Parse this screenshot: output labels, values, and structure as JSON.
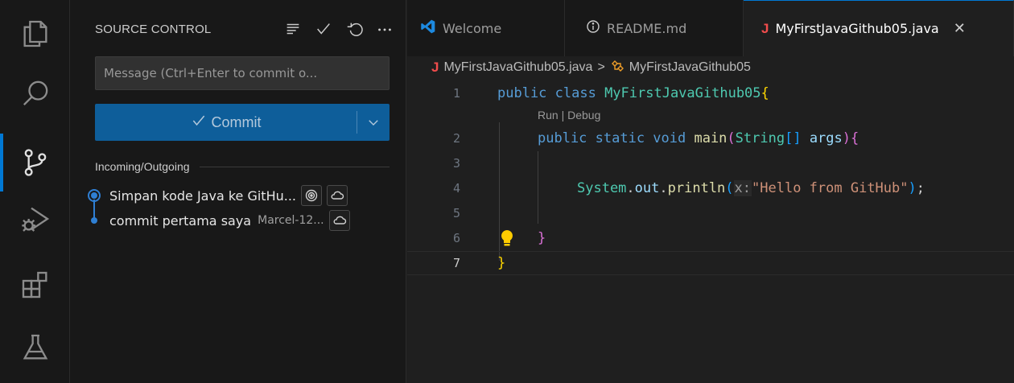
{
  "activity_bar": {
    "items": [
      "explorer-icon",
      "search-icon",
      "source-control-icon",
      "run-debug-icon",
      "extensions-icon",
      "testing-icon"
    ],
    "active": "source-control-icon"
  },
  "sidebar": {
    "title": "SOURCE CONTROL",
    "actions": [
      "view-as-tree-icon",
      "check-icon",
      "refresh-icon",
      "more-icon"
    ],
    "message_placeholder": "Message (Ctrl+Enter to commit o...",
    "commit_label": "Commit",
    "incoming_outgoing_label": "Incoming/Outgoing",
    "commits": [
      {
        "message": "Simpan kode Java ke GitHu...",
        "author": ""
      },
      {
        "message": "commit pertama saya",
        "author": "Marcel-12..."
      }
    ]
  },
  "editor": {
    "tabs": [
      {
        "label": "Welcome",
        "icon": "vscode-icon"
      },
      {
        "label": "README.md",
        "icon": "info-icon"
      },
      {
        "label": "MyFirstJavaGithub05.java",
        "icon": "java-icon",
        "active": true
      }
    ],
    "breadcrumb": {
      "file": "MyFirstJavaGithub05.java",
      "separator": ">",
      "symbol": "MyFirstJavaGithub05"
    },
    "codelens": "Run | Debug",
    "line_numbers": [
      "1",
      "2",
      "3",
      "4",
      "5",
      "6",
      "7"
    ],
    "current_line": "7",
    "code": {
      "l1_kw": "public class ",
      "l1_cls": "MyFirstJavaGithub05",
      "l1_brace": "{",
      "l2_kw": "public static void ",
      "l2_fn": "main",
      "l2_p1": "(",
      "l2_type": "String",
      "l2_arr": "[]",
      "l2_arg": " args",
      "l2_p2": ")",
      "l2_brace": "{",
      "l4_cls": "System",
      "l4_dot1": ".",
      "l4_field": "out",
      "l4_dot2": ".",
      "l4_fn": "println",
      "l4_p1": "(",
      "l4_hint": "x:",
      "l4_str": "\"Hello from GitHub\"",
      "l4_p2": ")",
      "l4_semi": ";",
      "l6_brace": "}",
      "l7_brace": "}"
    }
  }
}
